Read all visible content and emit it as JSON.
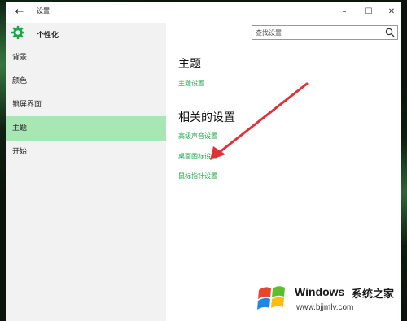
{
  "window": {
    "title": "设置",
    "back_glyph": "←",
    "minimize_glyph": "–",
    "maximize_glyph": "☐",
    "close_glyph": "✕"
  },
  "sidebar": {
    "header": "个性化",
    "items": [
      {
        "label": "背景",
        "active": false
      },
      {
        "label": "颜色",
        "active": false
      },
      {
        "label": "锁屏界面",
        "active": false
      },
      {
        "label": "主题",
        "active": true
      },
      {
        "label": "开始",
        "active": false
      }
    ]
  },
  "search": {
    "placeholder": "查找设置"
  },
  "main": {
    "section1_title": "主题",
    "section1_links": [
      "主题设置"
    ],
    "section2_title": "相关的设置",
    "section2_links": [
      "高级声音设置",
      "桌面图标设置",
      "鼠标指针设置"
    ]
  },
  "watermark": {
    "brand": "Windows",
    "brand_cn": "系统之家",
    "url": "www.bjjmlv.com"
  },
  "colors": {
    "accent_link": "#1aa84a",
    "active_item": "#a8e6b4",
    "arrow": "#e0303a"
  },
  "icons": [
    "back-arrow-icon",
    "gear-icon",
    "search-icon",
    "minimize-icon",
    "maximize-icon",
    "close-icon",
    "windows-logo-icon"
  ]
}
